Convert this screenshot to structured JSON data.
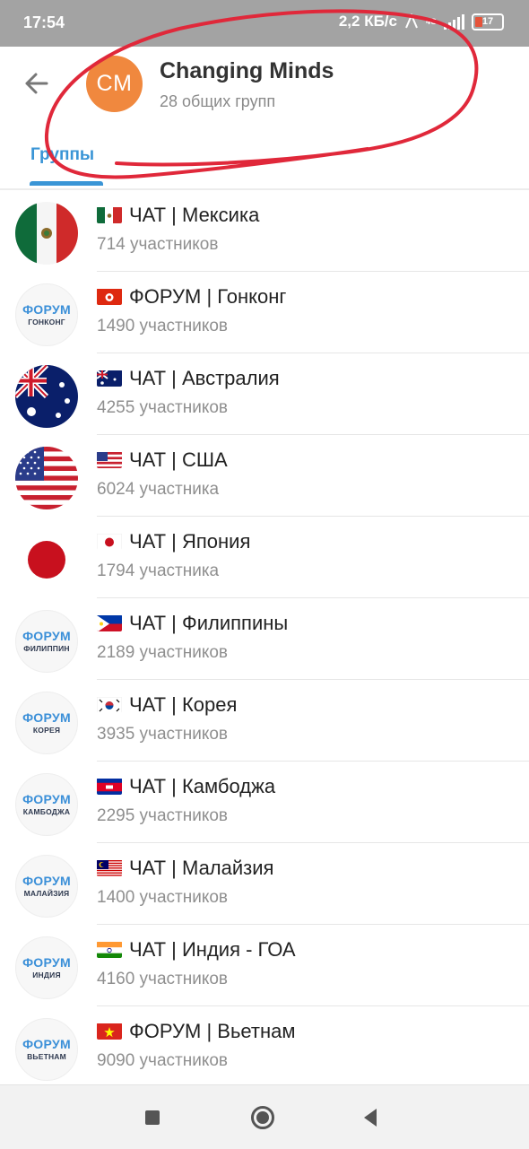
{
  "status_bar": {
    "time": "17:54",
    "speed": "2,2 КБ/с",
    "network": "4G",
    "battery": "17"
  },
  "header": {
    "avatar_initials": "CM",
    "title": "Changing Minds",
    "subtitle": "28 общих групп",
    "tab_label": "Группы"
  },
  "colors": {
    "accent": "#3a95d6",
    "avatar": "#f0883e",
    "annotation": "#e0283a"
  },
  "groups": [
    {
      "title": "ЧАТ | Мексика",
      "count": "714 участников",
      "flag": "mx",
      "avatar": "flag-mexico"
    },
    {
      "title": "ФОРУМ | Гонконг",
      "count": "1490 участников",
      "flag": "hk",
      "avatar": "forum",
      "avatar_line1": "ФОРУМ",
      "avatar_line2": "ГОНКОНГ"
    },
    {
      "title": "ЧАТ | Австралия",
      "count": "4255 участников",
      "flag": "au",
      "avatar": "flag-australia"
    },
    {
      "title": "ЧАТ | США",
      "count": "6024 участника",
      "flag": "us",
      "avatar": "flag-usa"
    },
    {
      "title": "ЧАТ | Япония",
      "count": "1794 участника",
      "flag": "jp",
      "avatar": "flag-japan"
    },
    {
      "title": "ЧАТ | Филиппины",
      "count": "2189 участников",
      "flag": "ph",
      "avatar": "forum",
      "avatar_line1": "ФОРУМ",
      "avatar_line2": "ФИЛИППИН"
    },
    {
      "title": "ЧАТ | Корея",
      "count": "3935 участников",
      "flag": "kr",
      "avatar": "forum",
      "avatar_line1": "ФОРУМ",
      "avatar_line2": "КОРЕЯ"
    },
    {
      "title": "ЧАТ | Камбоджа",
      "count": "2295 участников",
      "flag": "kh",
      "avatar": "forum",
      "avatar_line1": "ФОРУМ",
      "avatar_line2": "КАМБОДЖА"
    },
    {
      "title": "ЧАТ | Малайзия",
      "count": "1400 участников",
      "flag": "my",
      "avatar": "forum",
      "avatar_line1": "ФОРУМ",
      "avatar_line2": "МАЛАЙЗИЯ"
    },
    {
      "title": "ЧАТ | Индия - ГОА",
      "count": "4160 участников",
      "flag": "in",
      "avatar": "forum",
      "avatar_line1": "ФОРУМ",
      "avatar_line2": "ИНДИЯ"
    },
    {
      "title": "ФОРУМ | Вьетнам",
      "count": "9090 участников",
      "flag": "vn",
      "avatar": "forum",
      "avatar_line1": "ФОРУМ",
      "avatar_line2": "ВЬЕТНАМ"
    }
  ],
  "nav": {
    "icons": [
      "square-recents-icon",
      "circle-home-icon",
      "triangle-back-icon"
    ]
  }
}
